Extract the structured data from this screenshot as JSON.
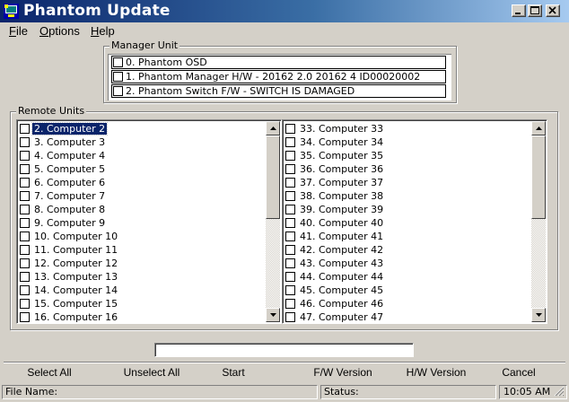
{
  "window": {
    "title": "Phantom Update"
  },
  "menu": [
    {
      "label": "File",
      "accel": "F",
      "rest": "ile"
    },
    {
      "label": "Options",
      "accel": "O",
      "rest": "ptions"
    },
    {
      "label": "Help",
      "accel": "H",
      "rest": "elp"
    }
  ],
  "manager_unit": {
    "label": "Manager Unit",
    "items": [
      {
        "text": "0. Phantom OSD",
        "checked": false
      },
      {
        "text": "1. Phantom Manager H/W - 20162 2.0 20162 4 ID00020002",
        "checked": false
      },
      {
        "text": "2. Phantom Switch F/W - SWITCH IS DAMAGED",
        "checked": false
      }
    ]
  },
  "remote_units": {
    "label": "Remote Units",
    "left_list": [
      "2. Computer 2",
      "3. Computer 3",
      "4. Computer 4",
      "5. Computer 5",
      "6. Computer 6",
      "7. Computer 7",
      "8. Computer 8",
      "9. Computer 9",
      "10. Computer 10",
      "11. Computer 11",
      "12. Computer 12",
      "13. Computer 13",
      "14. Computer 14",
      "15. Computer 15",
      "16. Computer 16"
    ],
    "right_list": [
      "33. Computer 33",
      "34. Computer 34",
      "35. Computer 35",
      "36. Computer 36",
      "37. Computer 37",
      "38. Computer 38",
      "39. Computer 39",
      "40. Computer 40",
      "41. Computer 41",
      "42. Computer 42",
      "43. Computer 43",
      "44. Computer 44",
      "45. Computer 45",
      "46. Computer 46",
      "47. Computer 47"
    ],
    "selected_left": "2. Computer 2"
  },
  "progress_text": "",
  "buttons": {
    "select_all": "Select All",
    "unselect_all": "Unselect All",
    "start": "Start",
    "fw_version": "F/W Version",
    "hw_version": "H/W Version",
    "cancel": "Cancel"
  },
  "statusbar": {
    "file_name": "File Name:",
    "status": "Status:",
    "time": "10:05 AM"
  },
  "colors": {
    "titlebar_start": "#0a246a",
    "titlebar_end": "#a6caf0",
    "selection": "#0a246a",
    "face": "#d4d0c8"
  }
}
